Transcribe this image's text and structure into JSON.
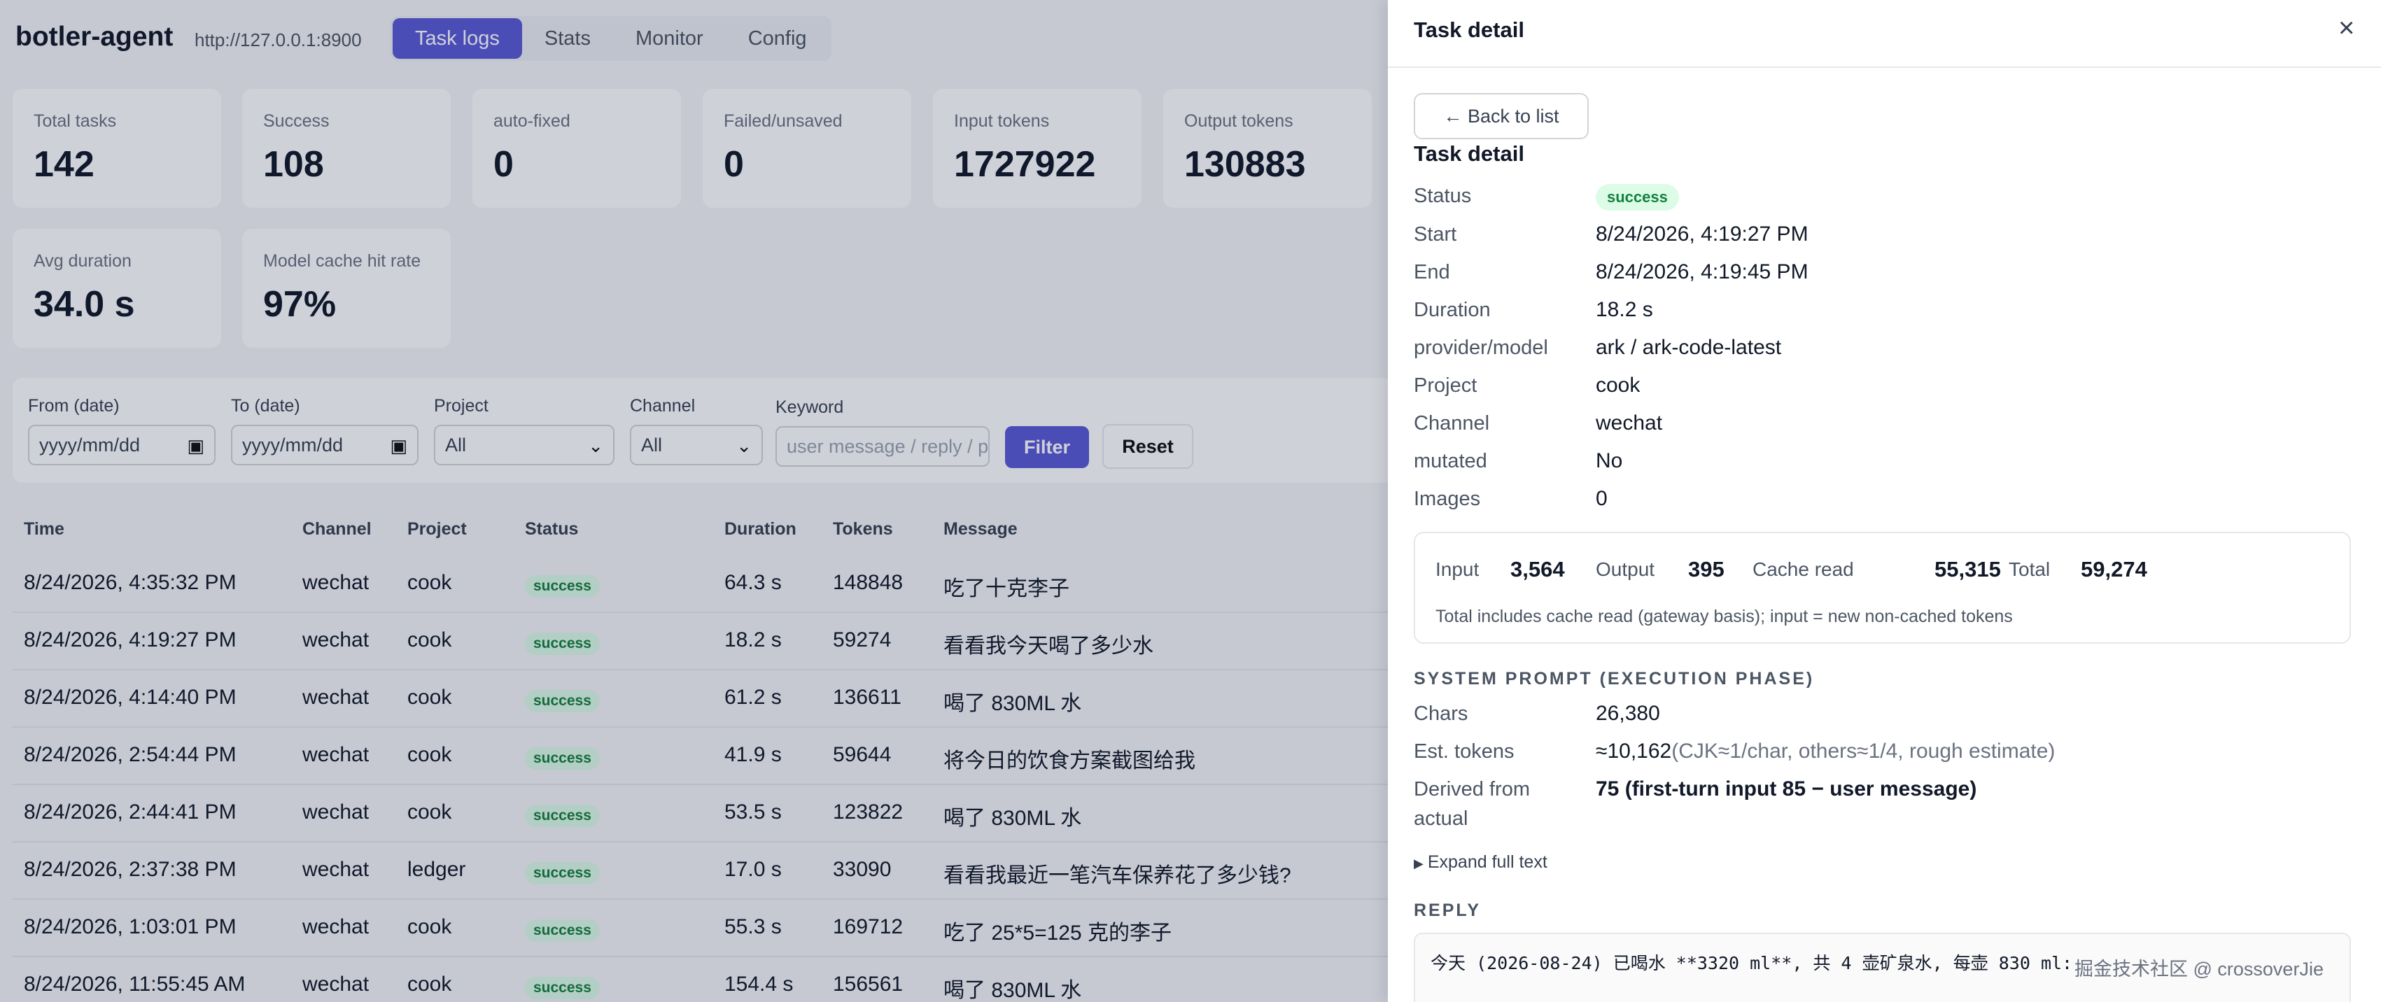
{
  "app": {
    "brand": "botler-agent",
    "api_url": "http://127.0.0.1:8900",
    "tabs": [
      "Task logs",
      "Stats",
      "Monitor",
      "Config"
    ],
    "active_tab": "Task logs"
  },
  "stats": [
    {
      "label": "Total tasks",
      "value": "142"
    },
    {
      "label": "Success",
      "value": "108"
    },
    {
      "label": "auto-fixed",
      "value": "0"
    },
    {
      "label": "Failed/unsaved",
      "value": "0"
    },
    {
      "label": "Input tokens",
      "value": "1727922"
    },
    {
      "label": "Output tokens",
      "value": "130883"
    },
    {
      "label": "Avg duration",
      "value": "34.0 s"
    },
    {
      "label": "Model cache hit rate",
      "value": "97%"
    }
  ],
  "filters": {
    "from_label": "From (date)",
    "from_value": "yyyy/mm/dd",
    "to_label": "To (date)",
    "to_value": "yyyy/mm/dd",
    "project_label": "Project",
    "project_value": "All",
    "channel_label": "Channel",
    "channel_value": "All",
    "keyword_label": "Keyword",
    "keyword_placeholder": "user message / reply / p",
    "filter_button": "Filter",
    "reset_button": "Reset"
  },
  "table": {
    "headers": [
      "Time",
      "Channel",
      "Project",
      "Status",
      "Duration",
      "Tokens",
      "Message"
    ],
    "rows": [
      {
        "time": "8/24/2026, 4:35:32 PM",
        "channel": "wechat",
        "project": "cook",
        "status": "success",
        "duration": "64.3 s",
        "tokens": "148848",
        "message": "吃了十克李子"
      },
      {
        "time": "8/24/2026, 4:19:27 PM",
        "channel": "wechat",
        "project": "cook",
        "status": "success",
        "duration": "18.2 s",
        "tokens": "59274",
        "message": "看看我今天喝了多少水"
      },
      {
        "time": "8/24/2026, 4:14:40 PM",
        "channel": "wechat",
        "project": "cook",
        "status": "success",
        "duration": "61.2 s",
        "tokens": "136611",
        "message": "喝了 830ML 水"
      },
      {
        "time": "8/24/2026, 2:54:44 PM",
        "channel": "wechat",
        "project": "cook",
        "status": "success",
        "duration": "41.9 s",
        "tokens": "59644",
        "message": "将今日的饮食方案截图给我"
      },
      {
        "time": "8/24/2026, 2:44:41 PM",
        "channel": "wechat",
        "project": "cook",
        "status": "success",
        "duration": "53.5 s",
        "tokens": "123822",
        "message": "喝了 830ML 水"
      },
      {
        "time": "8/24/2026, 2:37:38 PM",
        "channel": "wechat",
        "project": "ledger",
        "status": "success",
        "duration": "17.0 s",
        "tokens": "33090",
        "message": "看看我最近一笔汽车保养花了多少钱?"
      },
      {
        "time": "8/24/2026, 1:03:01 PM",
        "channel": "wechat",
        "project": "cook",
        "status": "success",
        "duration": "55.3 s",
        "tokens": "169712",
        "message": "吃了 25*5=125 克的李子"
      },
      {
        "time": "8/24/2026, 11:55:45 AM",
        "channel": "wechat",
        "project": "cook",
        "status": "success",
        "duration": "154.4 s",
        "tokens": "156561",
        "message": "喝了 830ML 水"
      }
    ]
  },
  "drawer": {
    "title": "Task detail",
    "close_icon": "×",
    "back_label": "← Back to list",
    "subtitle": "Task detail",
    "fields": [
      {
        "key": "Status",
        "value": "success"
      },
      {
        "key": "Start",
        "value": "8/24/2026, 4:19:27 PM"
      },
      {
        "key": "End",
        "value": "8/24/2026, 4:19:45 PM"
      },
      {
        "key": "Duration",
        "value": "18.2 s"
      },
      {
        "key": "provider/model",
        "value": "ark / ark-code-latest"
      },
      {
        "key": "Project",
        "value": "cook"
      },
      {
        "key": "Channel",
        "value": "wechat"
      },
      {
        "key": "mutated",
        "value": "No"
      },
      {
        "key": "Images",
        "value": "0"
      }
    ],
    "tokens": {
      "input_label": "Input",
      "input": "3,564",
      "output_label": "Output",
      "output": "395",
      "cache_label": "Cache read",
      "cache": "55,315",
      "total_label": "Total",
      "total": "59,274",
      "note": "Total includes cache read (gateway basis); input = new non-cached tokens"
    },
    "system_prompt": {
      "heading": "SYSTEM PROMPT (EXECUTION PHASE)",
      "chars_label": "Chars",
      "chars": "26,380",
      "est_label": "Est. tokens",
      "est_value": "≈10,162",
      "est_note": "(CJK≈1/char, others≈1/4, rough estimate)",
      "derived_label": "Derived from actual",
      "derived_value": "75 (first-turn input 85 − user message)",
      "expand_label": "Expand full text"
    },
    "reply": {
      "heading": "REPLY",
      "text": "今天 (2026-08-24) 已喝水 **3320 ml**, 共 4 壶矿泉水, 每壶 830 ml:"
    }
  },
  "watermark": "掘金技术社区 @ crossoverJie",
  "colors": {
    "accent": "#5b5bd6",
    "success_bg": "#dcfce7",
    "success_text": "#15803d"
  }
}
